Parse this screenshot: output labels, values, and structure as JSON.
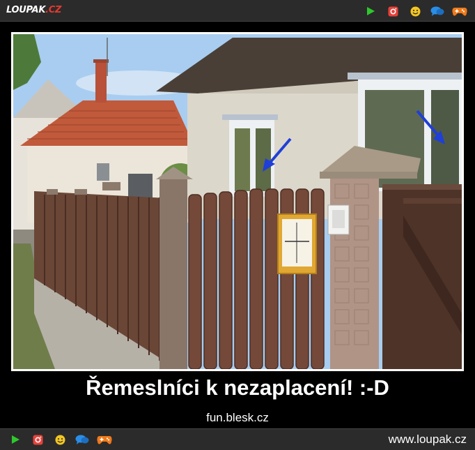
{
  "header": {
    "logo_main": "LOUPAK",
    "logo_suffix": ".CZ"
  },
  "nav_icons": [
    {
      "name": "play-icon",
      "color": "#2ec82e"
    },
    {
      "name": "instagram-icon",
      "color": "#e8413a"
    },
    {
      "name": "smiley-icon",
      "color": "#f3c623"
    },
    {
      "name": "chat-icon",
      "color": "#2a8ee8"
    },
    {
      "name": "gamepad-icon",
      "color": "#f07a1a"
    }
  ],
  "post": {
    "caption": "Řemeslníci k nezaplacení! :-D",
    "source": "fun.blesk.cz"
  },
  "footer": {
    "site": "www.loupak.cz"
  }
}
